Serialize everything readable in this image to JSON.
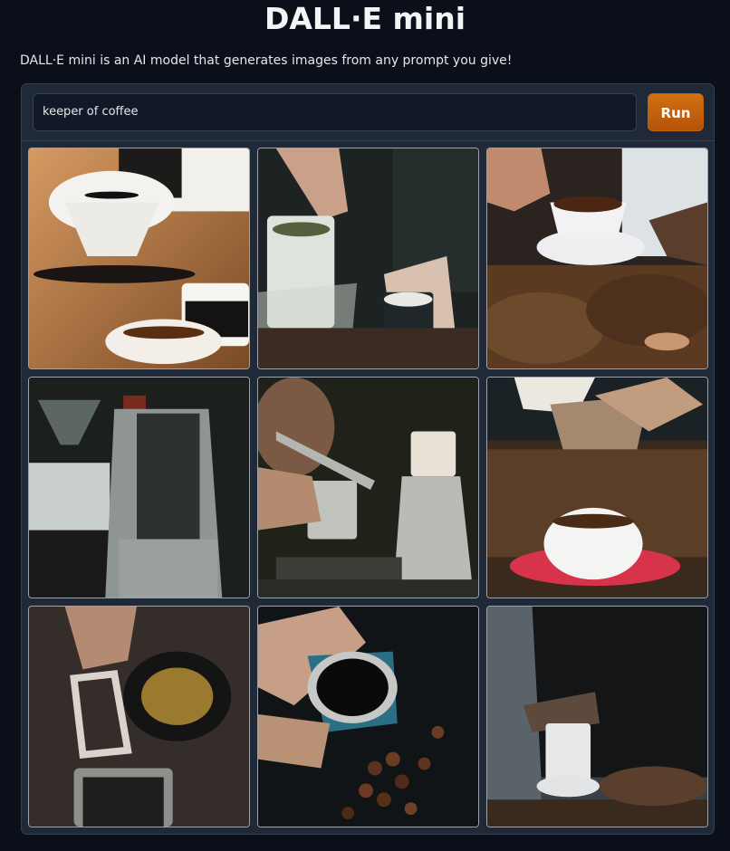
{
  "header": {
    "title": "DALL·E mini",
    "description": "DALL·E mini is an AI model that generates images from any prompt you give!"
  },
  "prompt": {
    "value": "keeper of coffee"
  },
  "run_button": {
    "label": "Run"
  },
  "gallery": {
    "images": [
      {
        "name": "coffee-image-1",
        "subject": "pouring into cups"
      },
      {
        "name": "coffee-image-2",
        "subject": "hands holding mugs"
      },
      {
        "name": "coffee-image-3",
        "subject": "cup on beans"
      },
      {
        "name": "coffee-image-4",
        "subject": "coffee machine"
      },
      {
        "name": "coffee-image-5",
        "subject": "barista with kettle"
      },
      {
        "name": "coffee-image-6",
        "subject": "pouring into cup with red saucer"
      },
      {
        "name": "coffee-image-7",
        "subject": "coffee pot with handle"
      },
      {
        "name": "coffee-image-8",
        "subject": "cup and scattered beans"
      },
      {
        "name": "coffee-image-9",
        "subject": "barista pouring"
      }
    ]
  },
  "colors": {
    "background": "#0b0f19",
    "panel": "#1f2937",
    "accent": "#c2610c"
  }
}
